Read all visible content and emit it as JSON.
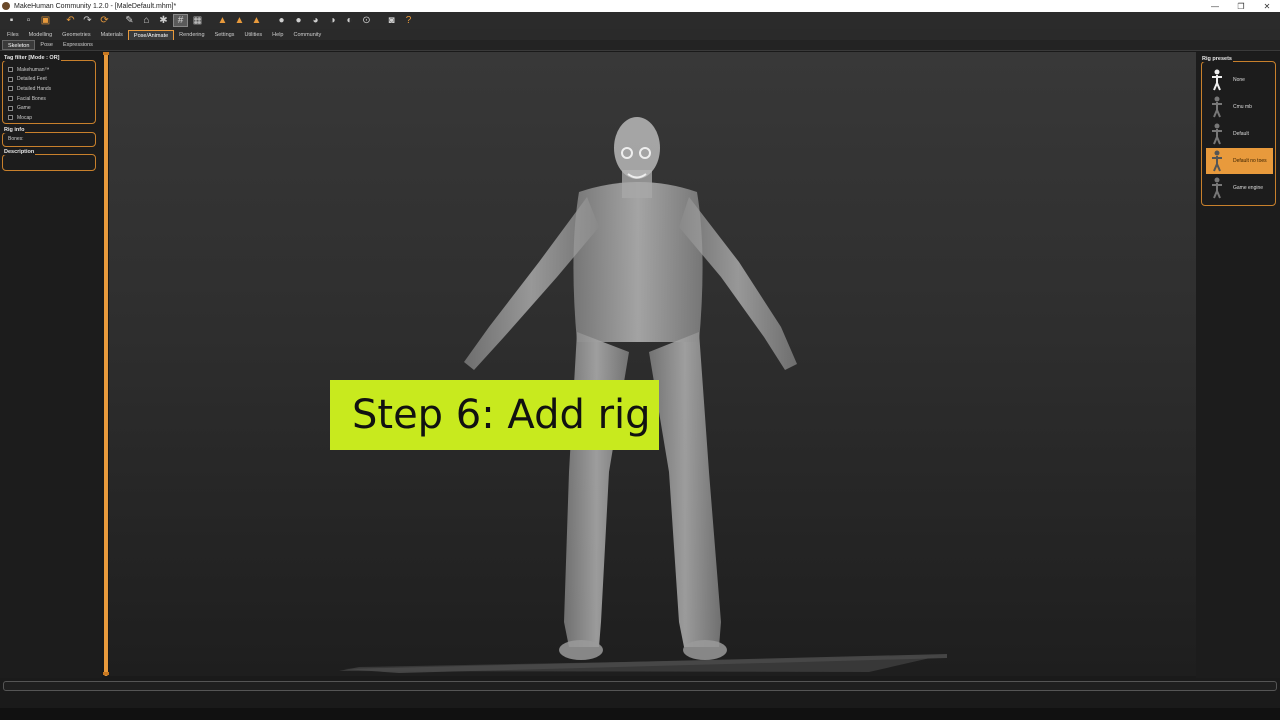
{
  "window": {
    "title": "MakeHuman Community 1.2.0 - [MaleDefault.mhm]*",
    "minimize": "—",
    "maximize": "❐",
    "close": "✕"
  },
  "toolbar": {
    "icons": [
      "save-icon",
      "load-icon",
      "export-icon",
      "undo-icon",
      "redo-icon",
      "reset-icon",
      "smooth-icon",
      "wireframe-icon",
      "pose-icon",
      "grid-icon",
      "checker-icon",
      "front-view-icon",
      "back-view-icon",
      "left-view-icon",
      "right-view-icon",
      "top-view-icon",
      "bottom-view-icon",
      "reset-camera-icon",
      "screenshot-icon",
      "help-icon"
    ]
  },
  "tabs": [
    "Files",
    "Modelling",
    "Geometries",
    "Materials",
    "Pose/Animate",
    "Rendering",
    "Settings",
    "Utilities",
    "Help",
    "Community"
  ],
  "active_tab": "Pose/Animate",
  "subtabs": [
    "Skeleton",
    "Pose",
    "Expressions"
  ],
  "active_subtab": "Skeleton",
  "left": {
    "tag_filter_title": "Tag filter [Mode : OR]",
    "tags": [
      "Makehuman™",
      "Detailed Feet",
      "Detailed Hands",
      "Facial Bones",
      "Game",
      "Mocap"
    ],
    "rig_info_title": "Rig info",
    "bones_label": "Bones:",
    "description_title": "Description"
  },
  "caption": "Step 6: Add rig",
  "right": {
    "rig_presets_title": "Rig presets",
    "presets": [
      {
        "label": "None",
        "selected": false
      },
      {
        "label": "Cmu mb",
        "selected": false
      },
      {
        "label": "Default",
        "selected": false
      },
      {
        "label": "Default no toes",
        "selected": true
      },
      {
        "label": "Game engine",
        "selected": false
      }
    ]
  },
  "colors": {
    "accent": "#e89a3c",
    "caption_bg": "#c8ea1e"
  }
}
